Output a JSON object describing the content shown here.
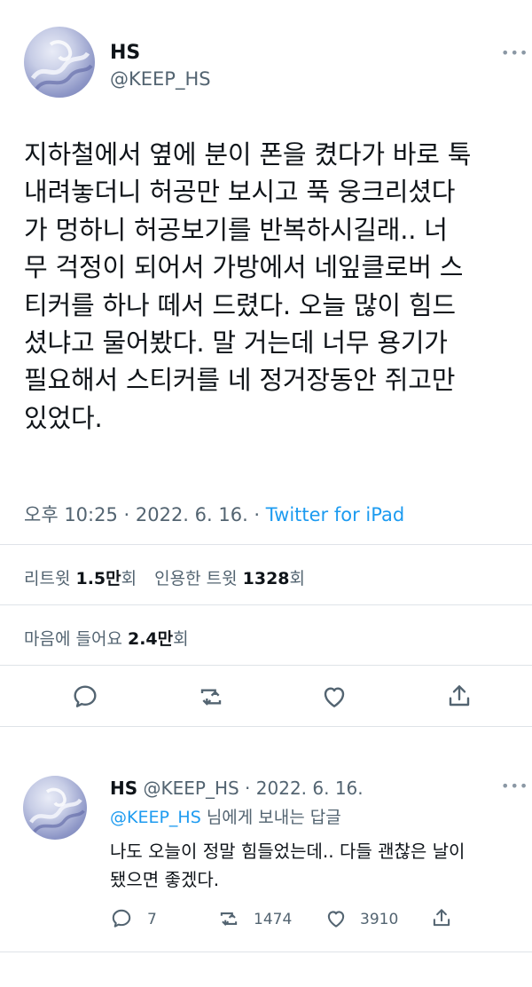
{
  "tweet": {
    "display_name": "HS",
    "handle": "@KEEP_HS",
    "more_icon": "more-dots-icon",
    "text": "지하철에서 옆에 분이 폰을 켰다가 바로 툭\n내려놓더니 허공만 보시고 푹 웅크리셨다\n가 멍하니 허공보기를 반복하시길래.. 너\n무 걱정이 되어서 가방에서 네잎클로버 스\n티커를 하나 떼서 드렸다. 오늘 많이 힘드\n셨냐고 물어봤다. 말 거는데 너무 용기가\n필요해서 스티커를 네 정거장동안 쥐고만\n있었다.",
    "timestamp": "오후 10:25 · 2022. 6. 16. · ",
    "source": "Twitter for iPad",
    "retweet_label": "리트윗 ",
    "retweet_count": "1.5만",
    "retweet_suffix": "회",
    "quote_label": "인용한 트윗 ",
    "quote_count": "1328",
    "quote_suffix": "회",
    "like_label": "마음에 들어요 ",
    "like_count": "2.4만",
    "like_suffix": "회",
    "actions": [
      "reply-icon",
      "retweet-icon",
      "like-icon",
      "share-icon"
    ]
  },
  "reply": {
    "display_name": "HS",
    "handle_date": " @KEEP_HS · 2022. 6. 16.",
    "to_mention": "@KEEP_HS",
    "to_suffix": " 님에게 보내는 답글",
    "text": "나도 오늘이 정말 힘들었는데.. 다들 괜찮은 날이\n됐으면 좋겠다.",
    "reply_count": "7",
    "retweet_count": "1474",
    "like_count": "3910",
    "more_icon": "more-dots-icon"
  },
  "colors": {
    "accent": "#1d9bf0",
    "text": "#0f1419",
    "muted": "#536471",
    "divider": "#dfe3e8"
  }
}
